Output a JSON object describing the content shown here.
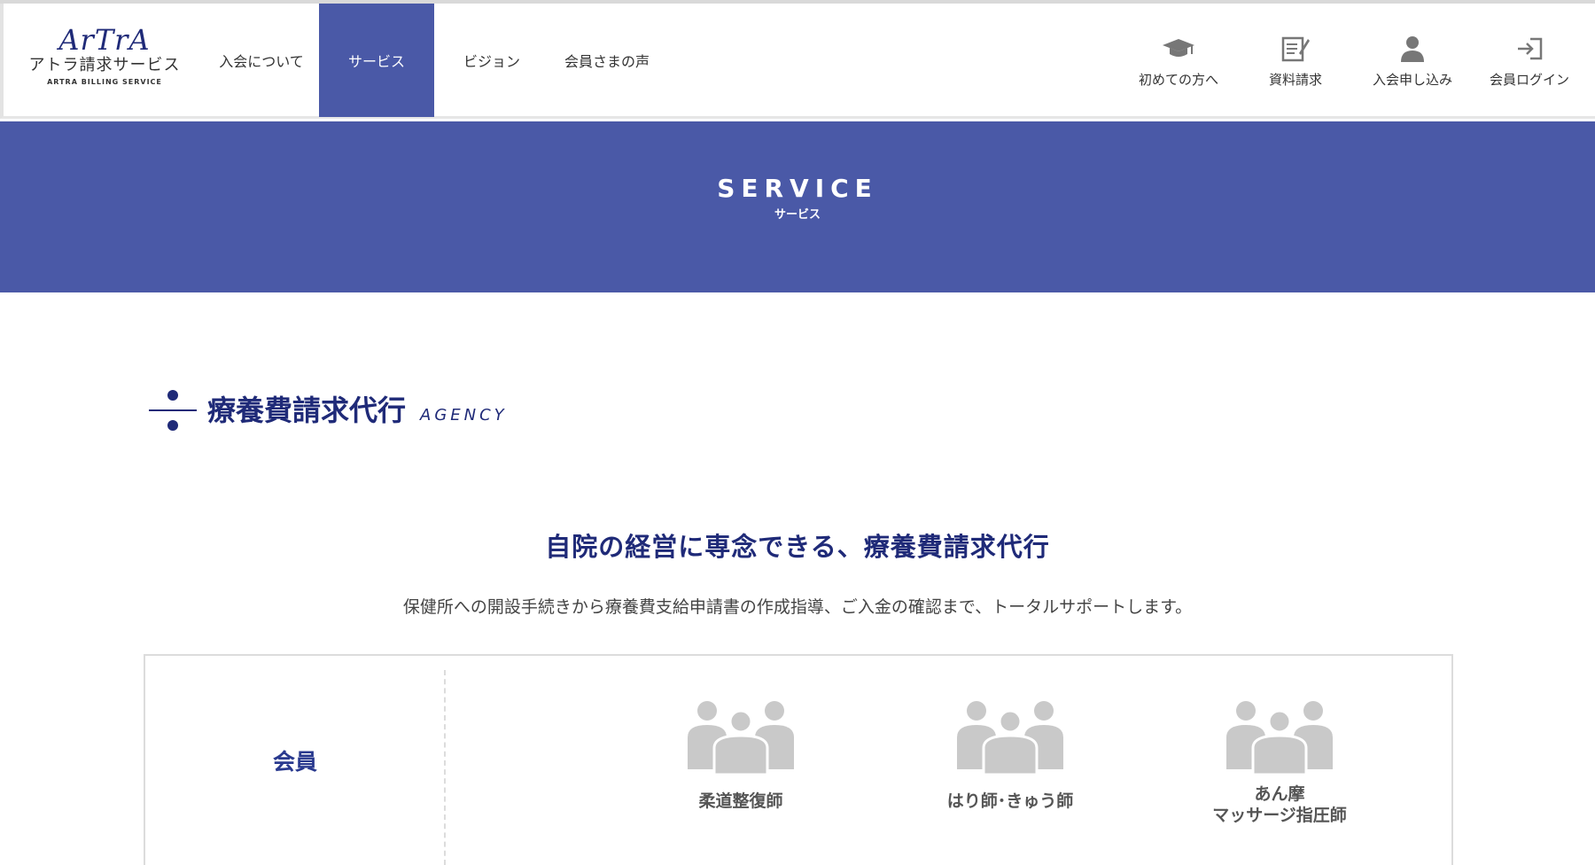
{
  "header": {
    "logo": {
      "mark": "ArTrA",
      "jp": "アトラ請求サービス",
      "en": "ARTRA BILLING SERVICE"
    },
    "nav": [
      {
        "label": "入会について"
      },
      {
        "label": "サービス"
      },
      {
        "label": "ビジョン"
      },
      {
        "label": "会員さまの声"
      }
    ],
    "utility": [
      {
        "label": "初めての方へ",
        "icon": "graduation-cap-icon"
      },
      {
        "label": "資料請求",
        "icon": "document-pen-icon"
      },
      {
        "label": "入会申し込み",
        "icon": "user-icon"
      },
      {
        "label": "会員ログイン",
        "icon": "login-icon"
      }
    ]
  },
  "hero": {
    "title": "SERVICE",
    "subtitle": "サービス"
  },
  "section": {
    "title": "療養費請求代行",
    "title_en": "AGENCY",
    "icon": "divide-icon"
  },
  "lead": {
    "headline": "自院の経営に専念できる、療養費請求代行",
    "description": "保健所への開設手続きから療養費支給申請書の作成指導、ご入金の確認まで、トータルサポートします。"
  },
  "members": {
    "label": "会員",
    "items": [
      {
        "name": "柔道整復師",
        "icon": "group-icon"
      },
      {
        "name": "はり師･きゅう師",
        "icon": "group-icon"
      },
      {
        "name_line1": "あん摩",
        "name_line2": "マッサージ指圧師",
        "icon": "group-icon"
      }
    ]
  },
  "colors": {
    "accent": "#4a59a7",
    "brand_dark": "#1f2a78",
    "icon_gray": "#c9c9c9"
  }
}
